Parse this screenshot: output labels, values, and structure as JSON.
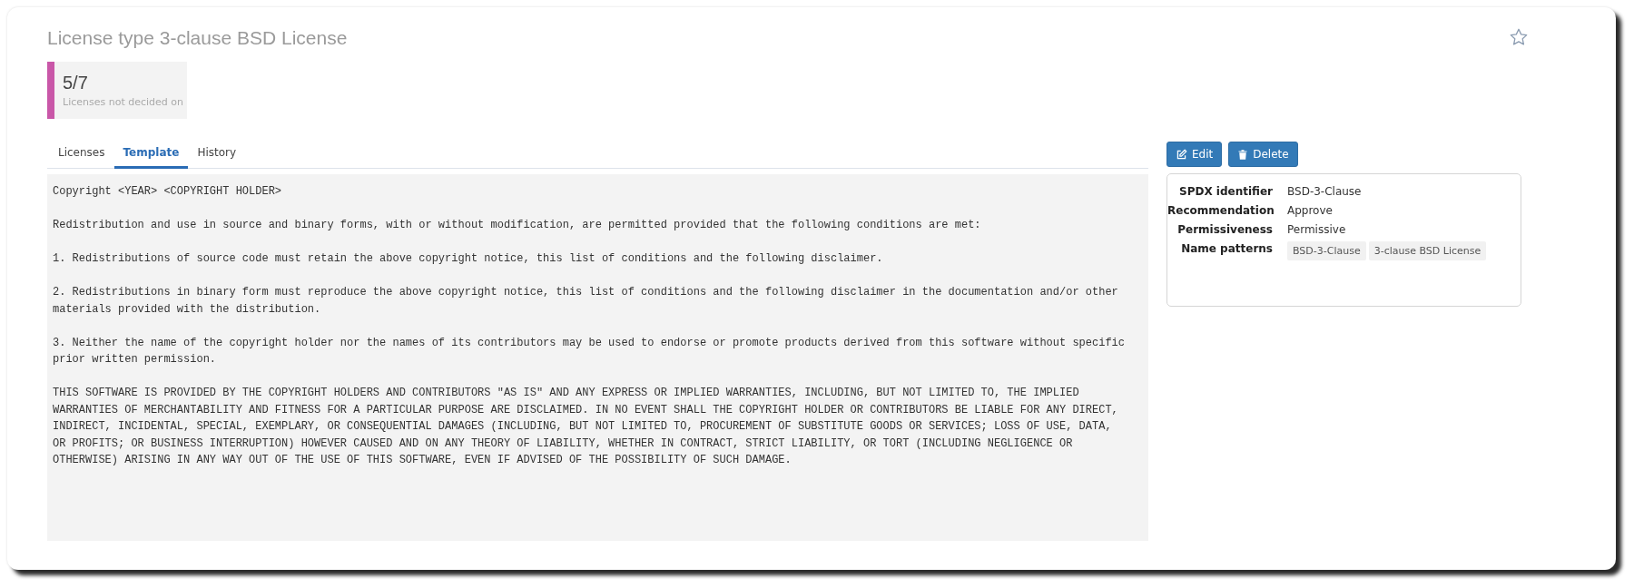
{
  "title": "License type 3-clause BSD License",
  "favorite": false,
  "stat": {
    "value": "5/7",
    "label": "Licenses not decided on"
  },
  "tabs": [
    {
      "label": "Licenses",
      "selected": false
    },
    {
      "label": "Template",
      "selected": true
    },
    {
      "label": "History",
      "selected": false
    }
  ],
  "template_text": "Copyright <YEAR> <COPYRIGHT HOLDER>\n\nRedistribution and use in source and binary forms, with or without modification, are permitted provided that the following conditions are met:\n\n1. Redistributions of source code must retain the above copyright notice, this list of conditions and the following disclaimer.\n\n2. Redistributions in binary form must reproduce the above copyright notice, this list of conditions and the following disclaimer in the documentation and/or other\nmaterials provided with the distribution.\n\n3. Neither the name of the copyright holder nor the names of its contributors may be used to endorse or promote products derived from this software without specific\nprior written permission.\n\nTHIS SOFTWARE IS PROVIDED BY THE COPYRIGHT HOLDERS AND CONTRIBUTORS \"AS IS\" AND ANY EXPRESS OR IMPLIED WARRANTIES, INCLUDING, BUT NOT LIMITED TO, THE IMPLIED\nWARRANTIES OF MERCHANTABILITY AND FITNESS FOR A PARTICULAR PURPOSE ARE DISCLAIMED. IN NO EVENT SHALL THE COPYRIGHT HOLDER OR CONTRIBUTORS BE LIABLE FOR ANY DIRECT,\nINDIRECT, INCIDENTAL, SPECIAL, EXEMPLARY, OR CONSEQUENTIAL DAMAGES (INCLUDING, BUT NOT LIMITED TO, PROCUREMENT OF SUBSTITUTE GOODS OR SERVICES; LOSS OF USE, DATA,\nOR PROFITS; OR BUSINESS INTERRUPTION) HOWEVER CAUSED AND ON ANY THEORY OF LIABILITY, WHETHER IN CONTRACT, STRICT LIABILITY, OR TORT (INCLUDING NEGLIGENCE OR\nOTHERWISE) ARISING IN ANY WAY OUT OF THE USE OF THIS SOFTWARE, EVEN IF ADVISED OF THE POSSIBILITY OF SUCH DAMAGE.",
  "buttons": [
    {
      "label": "Edit",
      "kind": "edit"
    },
    {
      "label": "Delete",
      "kind": "delete"
    }
  ],
  "details": [
    {
      "label": "SPDX identifier",
      "value": "BSD-3-Clause"
    },
    {
      "label": "Recommendation",
      "value": "Approve"
    },
    {
      "label": "Permissiveness",
      "value": "Permissive"
    },
    {
      "label": "Name patterns",
      "tags": [
        "BSD-3-Clause",
        "3-clause BSD License"
      ]
    }
  ]
}
